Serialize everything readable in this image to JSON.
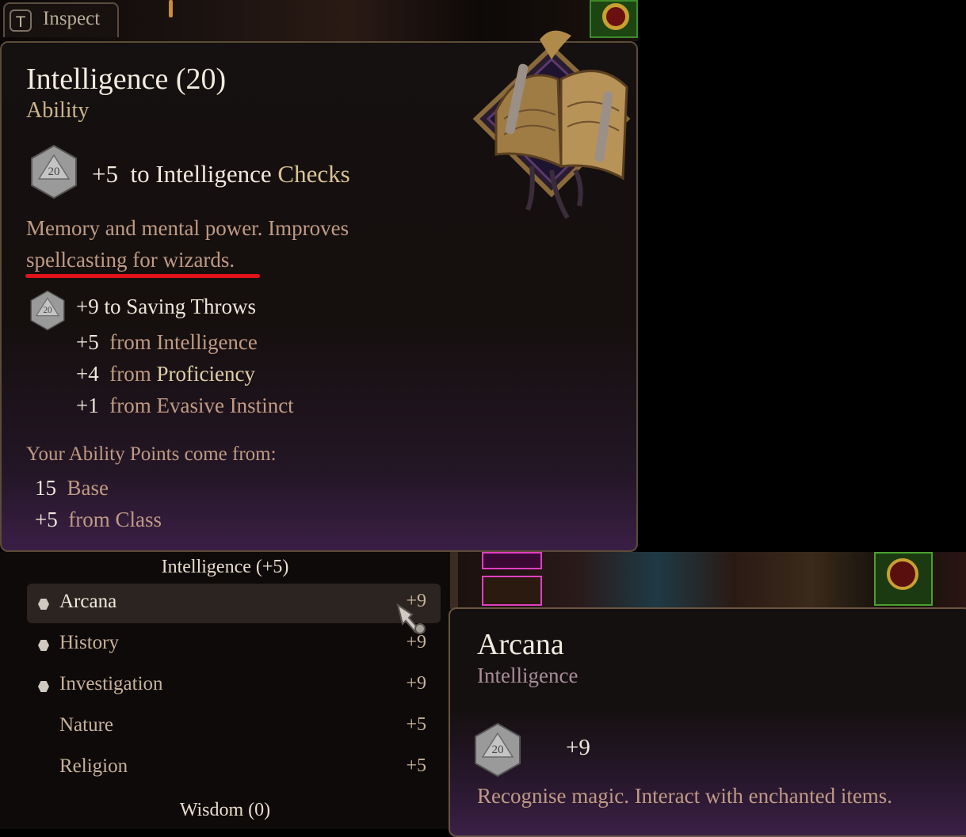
{
  "top_bar": {
    "inspect_key": "T",
    "inspect_label": "Inspect"
  },
  "ability_tooltip": {
    "title": "Intelligence (20)",
    "subtitle": "Ability",
    "checks": {
      "bonus": "+5",
      "text": "to Intelligence",
      "highlight": "Checks"
    },
    "die_label": "20",
    "description_line1": "Memory and mental power. Improves",
    "description_line2": "spellcasting for wizards.",
    "saving_throws": "+9 to Saving Throws",
    "sources": [
      {
        "value": "+5",
        "from": "from",
        "name": "Intelligence"
      },
      {
        "value": "+4",
        "from": "from",
        "name": "Proficiency"
      },
      {
        "value": "+1",
        "from": "from",
        "name": "Evasive Instinct"
      }
    ],
    "points_title": "Your Ability Points come from:",
    "points": [
      {
        "value": "15",
        "label": "Base"
      },
      {
        "value": "+5",
        "label": "from Class"
      }
    ]
  },
  "skills_panel": {
    "section_title": "Intelligence (+5)",
    "skills": [
      {
        "name": "Arcana",
        "value": "+9",
        "proficient": true,
        "active": true
      },
      {
        "name": "History",
        "value": "+9",
        "proficient": true,
        "active": false
      },
      {
        "name": "Investigation",
        "value": "+9",
        "proficient": true,
        "active": false
      },
      {
        "name": "Nature",
        "value": "+5",
        "proficient": false,
        "active": false
      },
      {
        "name": "Religion",
        "value": "+5",
        "proficient": false,
        "active": false
      }
    ],
    "next_section_title": "Wisdom (0)"
  },
  "arcana_tooltip": {
    "title": "Arcana",
    "subtitle": "Intelligence",
    "die_label": "20",
    "value": "+9",
    "description": "Recognise magic. Interact with enchanted items."
  },
  "colors": {
    "title": "#f2ebdf",
    "gold": "#cdb58a",
    "description": "#c09a83",
    "underline": "#e0131a",
    "panel_bg": "#151110",
    "purple_glow": "#3a1f46"
  }
}
